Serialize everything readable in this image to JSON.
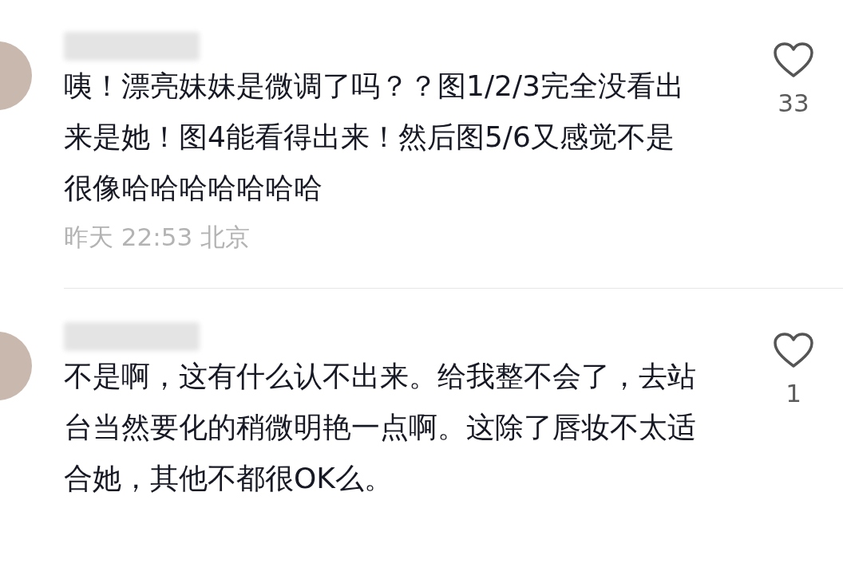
{
  "comments": [
    {
      "text": "咦！漂亮妹妹是微调了吗？？图1/2/3完全没看出来是她！图4能看得出来！然后图5/6又感觉不是很像哈哈哈哈哈哈哈",
      "meta": "昨天 22:53 北京",
      "likes": "33",
      "liked": false
    },
    {
      "text": "不是啊，这有什么认不出来。给我整不会了，去站台当然要化的稍微明艳一点啊。这除了唇妆不太适合她，其他不都很OK么。",
      "likes": "1",
      "liked": false
    }
  ]
}
